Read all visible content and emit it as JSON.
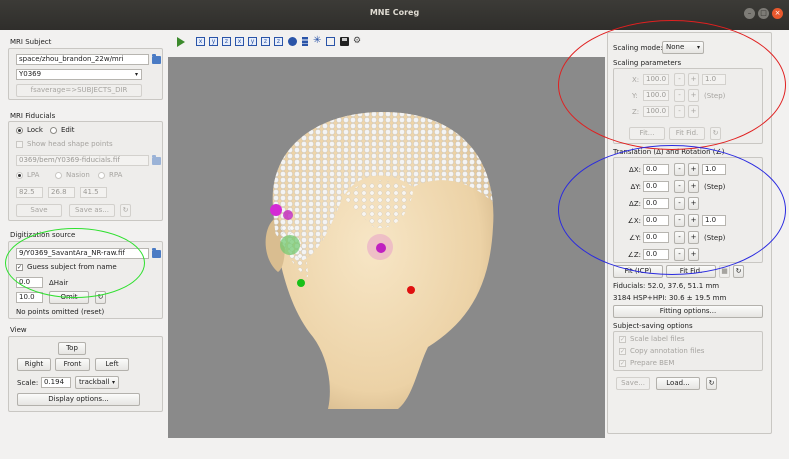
{
  "window": {
    "title": "MNE Coreg"
  },
  "mri_subject": {
    "group_title": "MRI Subject",
    "subjects_dir": "space/zhou_brandon_22w/mri",
    "subject": "Y0369",
    "fsaverage_button": "fsaverage=>SUBJECTS_DIR"
  },
  "mri_fiducials": {
    "group_title": "MRI Fiducials",
    "lock_label": "Lock",
    "edit_label": "Edit",
    "show_head_shape_label": "Show head shape points",
    "fiducials_file": "0369/bem/Y0369-fiducials.fif",
    "lpa_label": "LPA",
    "nasion_label": "Nasion",
    "rpa_label": "RPA",
    "x_value": "82.5",
    "y_value": "26.8",
    "z_value": "41.5",
    "save_button": "Save",
    "save_as_button": "Save as..."
  },
  "digitization": {
    "group_title": "Digitization source",
    "file": "9/Y0369_SavantAra_NR-raw.fif",
    "guess_label": "Guess subject from name",
    "hair_value": "0.0",
    "hair_label": "ΔHair",
    "omit_value": "10.0",
    "omit_button": "Omit",
    "status": "No points omitted (reset)"
  },
  "view": {
    "group_title": "View",
    "top_button": "Top",
    "right_button": "Right",
    "front_button": "Front",
    "left_button": "Left",
    "scale_label": "Scale:",
    "scale_value": "0.194",
    "mode_value": "trackball",
    "display_options_button": "Display options..."
  },
  "scaling": {
    "mode_label": "Scaling mode:",
    "mode_value": "None",
    "params_title": "Scaling parameters",
    "x_label": "X:",
    "y_label": "Y:",
    "z_label": "Z:",
    "x_value": "100.0",
    "y_value": "100.0",
    "z_value": "100.0",
    "step_value": "1.0",
    "step_label": "(Step)",
    "fit_a_button": "Fit...",
    "fit_fid_button": "Fit Fid.",
    "minus": "-",
    "plus": "+"
  },
  "translation": {
    "title": "Translation (Δ) and Rotation (∠)",
    "dx_label": "ΔX:",
    "dy_label": "ΔY:",
    "dz_label": "ΔZ:",
    "rx_label": "∠X:",
    "ry_label": "∠Y:",
    "rz_label": "∠Z:",
    "dx_value": "0.0",
    "dy_value": "0.0",
    "dz_value": "0.0",
    "rx_value": "0.0",
    "ry_value": "0.0",
    "rz_value": "0.0",
    "trans_step": "1.0",
    "rot_step": "1.0",
    "step_label": "(Step)"
  },
  "fitting": {
    "fit_icp_button": "Fit (ICP)",
    "fit_fid_button": "Fit Fid.",
    "fiducials_text": "Fiducials: 52.0, 37.6, 51.1 mm",
    "hsp_text": "3184 HSP+HPI: 30.6 ± 19.5 mm",
    "fitting_options_button": "Fitting options..."
  },
  "saving": {
    "title": "Subject-saving options",
    "scale_label_files": "Scale label files",
    "copy_annotation": "Copy annotation files",
    "prepare_bem": "Prepare BEM",
    "save_button": "Save...",
    "load_button": "Load..."
  },
  "colors": {
    "red_annotation": "#e02020",
    "blue_annotation": "#2a2ae0",
    "green_annotation": "#2ee02e",
    "viewport_bg": "#8a8a8a",
    "head_color": "#f1dcb8"
  },
  "icons": [
    "play-icon",
    "view-x-icon",
    "view-y-icon",
    "view-z-icon",
    "sphere-icon",
    "save-icon",
    "settings-icon"
  ]
}
